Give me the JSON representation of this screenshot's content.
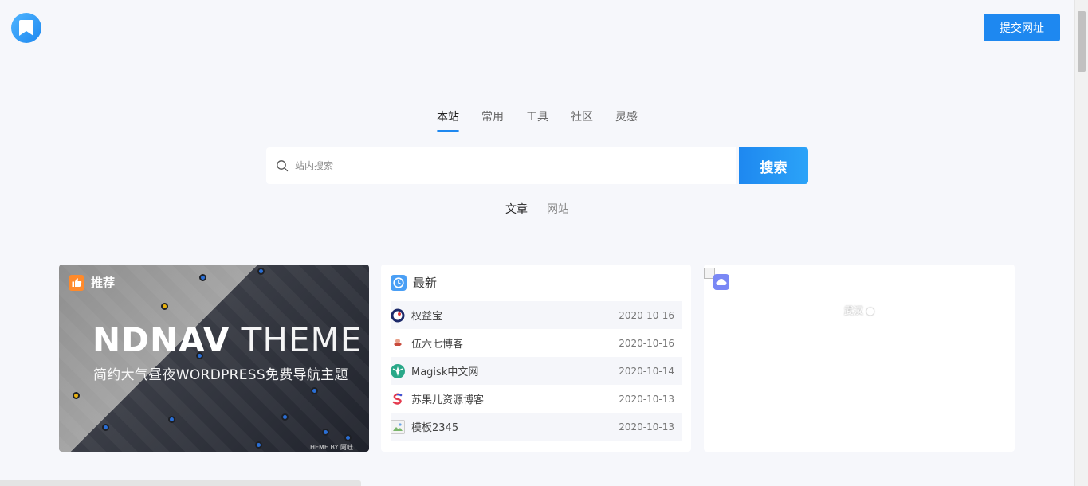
{
  "header": {
    "submit_label": "提交网址"
  },
  "search": {
    "tabs": [
      {
        "label": "本站",
        "active": true
      },
      {
        "label": "常用",
        "active": false
      },
      {
        "label": "工具",
        "active": false
      },
      {
        "label": "社区",
        "active": false
      },
      {
        "label": "灵感",
        "active": false
      }
    ],
    "placeholder": "站内搜索",
    "button_label": "搜索",
    "sub_tabs": [
      {
        "label": "文章",
        "active": true
      },
      {
        "label": "网站",
        "active": false
      }
    ]
  },
  "recommend": {
    "title": "推荐",
    "banner_bold": "NDNAV",
    "banner_light": " THEME",
    "banner_sub": "简约大气昼夜WORDPRESS免费导航主题",
    "banner_by": "THEME BY 阿吐"
  },
  "latest": {
    "title": "最新",
    "items": [
      {
        "name": "权益宝",
        "date": "2020-10-16",
        "icon": "quanyibao-logo-icon"
      },
      {
        "name": "伍六七博客",
        "date": "2020-10-16",
        "icon": "avatar-icon"
      },
      {
        "name": "Magisk中文网",
        "date": "2020-10-14",
        "icon": "magisk-logo-icon"
      },
      {
        "name": "苏果儿资源博客",
        "date": "2020-10-13",
        "icon": "s-logo-icon"
      },
      {
        "name": "模板2345",
        "date": "2020-10-13",
        "icon": "broken-image-icon"
      }
    ]
  },
  "weather": {
    "location": "武汉"
  },
  "colors": {
    "accent": "#1e88f0",
    "background": "#f6f7fb"
  }
}
